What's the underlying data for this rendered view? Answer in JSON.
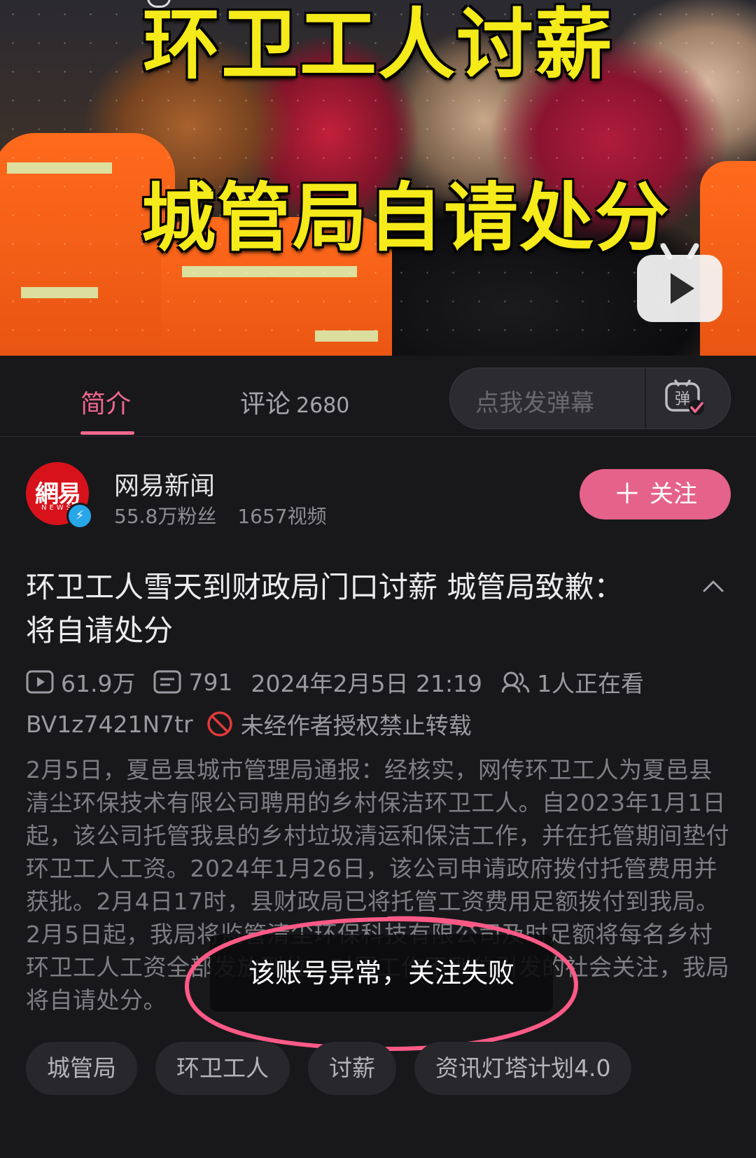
{
  "video": {
    "headline_line1": "环卫工人讨薪",
    "headline_line2": "城管局自请处分",
    "play_icon": "bilibili-tv-play-icon"
  },
  "tabs": [
    {
      "label": "简介",
      "active": true
    },
    {
      "label": "评论",
      "count": "2680",
      "active": false
    }
  ],
  "danmu": {
    "placeholder": "点我发弹幕",
    "button_icon": "danmu-toggle-icon"
  },
  "uploader": {
    "name": "网易新闻",
    "avatar_text": "網易",
    "avatar_subtext": "NEWS",
    "followers": "55.8万粉丝",
    "videos": "1657视频",
    "follow_label": "关注"
  },
  "video_title": "环卫工人雪天到财政局门口讨薪 城管局致歉：将自请处分",
  "meta": {
    "views": "61.9万",
    "danmaku": "791",
    "datetime": "2024年2月5日 21:19",
    "watching": "1人正在看",
    "bvid": "BV1z7421N7tr",
    "no_repost": "未经作者授权禁止转载"
  },
  "description": "2月5日，夏邑县城市管理局通报：经核实，网传环卫工人为夏邑县清尘环保技术有限公司聘用的乡村保洁环卫工人。自2023年1月1日起，该公司托管我县的乡村垃圾清运和保洁工作，并在托管期间垫付环卫工人工资。2024年1月26日，该公司申请政府拨付托管费用并获批。2月4日17时，县财政局已将托管工资费用足额拨付到我局。2月5日起，我局将监管清尘环保科技有限公司及时足额将每名乡村环卫工人工资全部发放到位。对因工作不到位引发的社会关注，我局将自请处分。",
  "toast": "该账号异常，关注失败",
  "tags": [
    "城管局",
    "环卫工人",
    "讨薪",
    "资讯灯塔计划4.0"
  ],
  "colors": {
    "accent": "#f0688f",
    "follow_button": "#e5628a",
    "background": "#18181b",
    "headline": "#f5ea1a",
    "annotation": "#ff5a87"
  }
}
